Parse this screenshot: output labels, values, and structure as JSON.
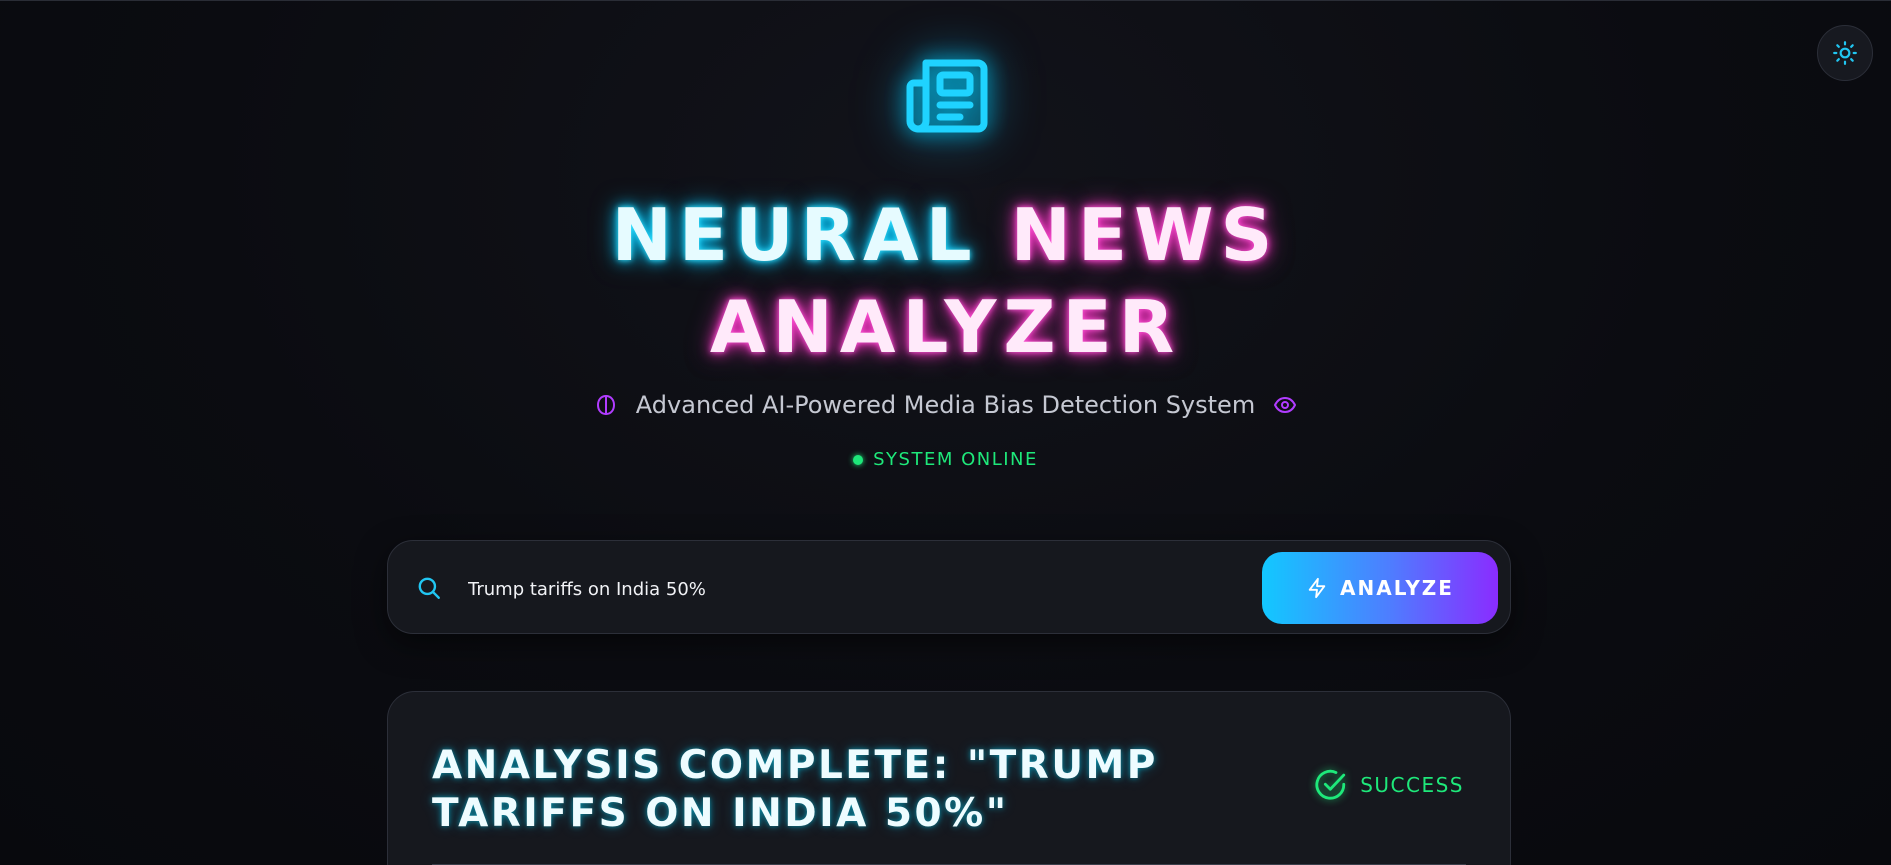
{
  "header": {
    "theme_toggle_icon": "sun-icon",
    "logo_icon": "newspaper-icon",
    "title_part1": "NEURAL",
    "title_part2": "NEWS",
    "title_part3": "ANALYZER",
    "subtitle": "Advanced AI-Powered Media Bias Detection System",
    "subtitle_left_icon": "brain-icon",
    "subtitle_right_icon": "eye-icon",
    "status_text": "SYSTEM ONLINE"
  },
  "search": {
    "icon": "search-icon",
    "value": "Trump tariffs on India 50%",
    "button_icon": "zap-icon",
    "button_label": "ANALYZE"
  },
  "result": {
    "title": "ANALYSIS COMPLETE: \"TRUMP TARIFFS ON INDIA 50%\"",
    "status_icon": "check-circle-icon",
    "status_label": "SUCCESS"
  },
  "colors": {
    "accent_cyan": "#00c8ff",
    "accent_pink": "#ff2fc6",
    "accent_purple": "#8a2cff",
    "status_green": "#1ee87a",
    "background": "#0b0c10"
  }
}
